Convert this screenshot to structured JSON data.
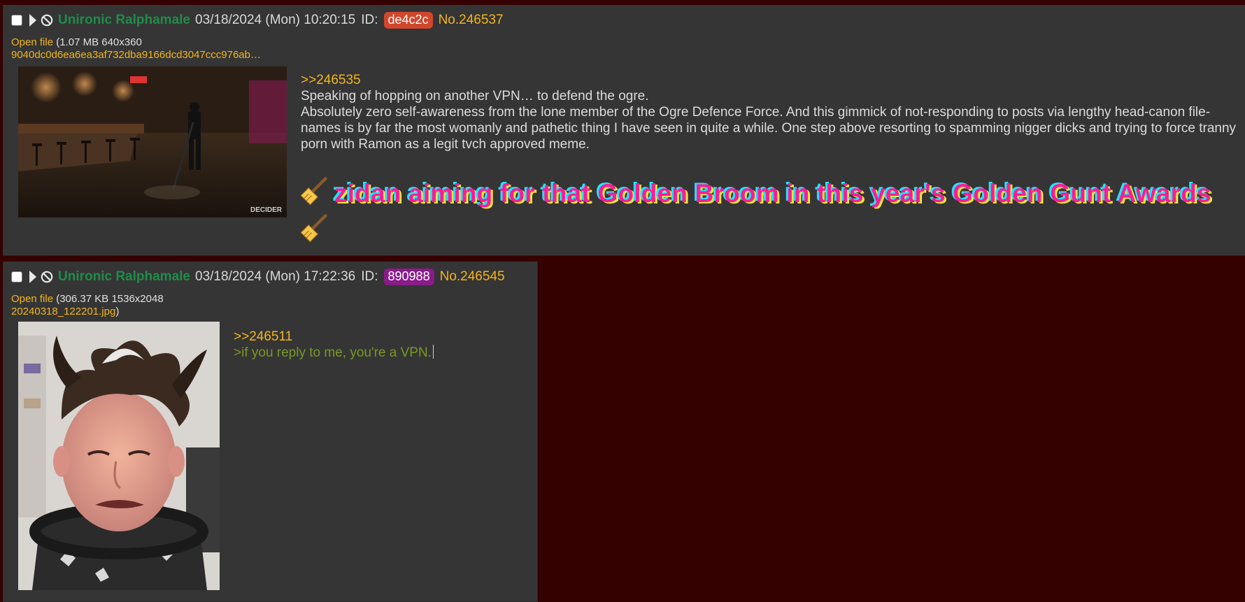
{
  "posts": [
    {
      "name": "Unironic Ralphamale",
      "datetime": "03/18/2024 (Mon) 10:20:15",
      "id_label": "ID:",
      "id": "de4c2c",
      "id_color": "#d2462b",
      "number": "No.246537",
      "file_link": "Open file",
      "file_meta": "(1.07 MB 640x360",
      "file_name": "9040dc0d6ea6ea3af732dba9166dcd3047ccc976ab…",
      "thumb_watermark": "DECIDER",
      "quote": ">>246535",
      "lines": [
        "Speaking of hopping on another VPN… to defend the ogre.",
        "Absolutely zero self-awareness from the lone member of the Ogre Defence Force. And this gimmick of not-responding to posts via lengthy head-canon file-names is by far the most womanly and pathetic thing I have seen in quite a while. One step above resorting to spamming nigger dicks and trying to force tranny porn with Ramon as a legit tvch approved meme."
      ],
      "fancy_text": "zidan aiming for that Golden Broom in this year's Golden Gunt Awards",
      "fancy_icon": "broom-icon"
    },
    {
      "name": "Unironic Ralphamale",
      "datetime": "03/18/2024 (Mon) 17:22:36",
      "id_label": "ID:",
      "id": "890988",
      "id_color": "#8a1c8a",
      "number": "No.246545",
      "file_link": "Open file",
      "file_meta": "(306.37 KB 1536x2048",
      "file_name": "20240318_122201.jpg",
      "file_close": ")",
      "quote": ">>246511",
      "greentext": ">if you reply to me, you're a VPN."
    }
  ]
}
